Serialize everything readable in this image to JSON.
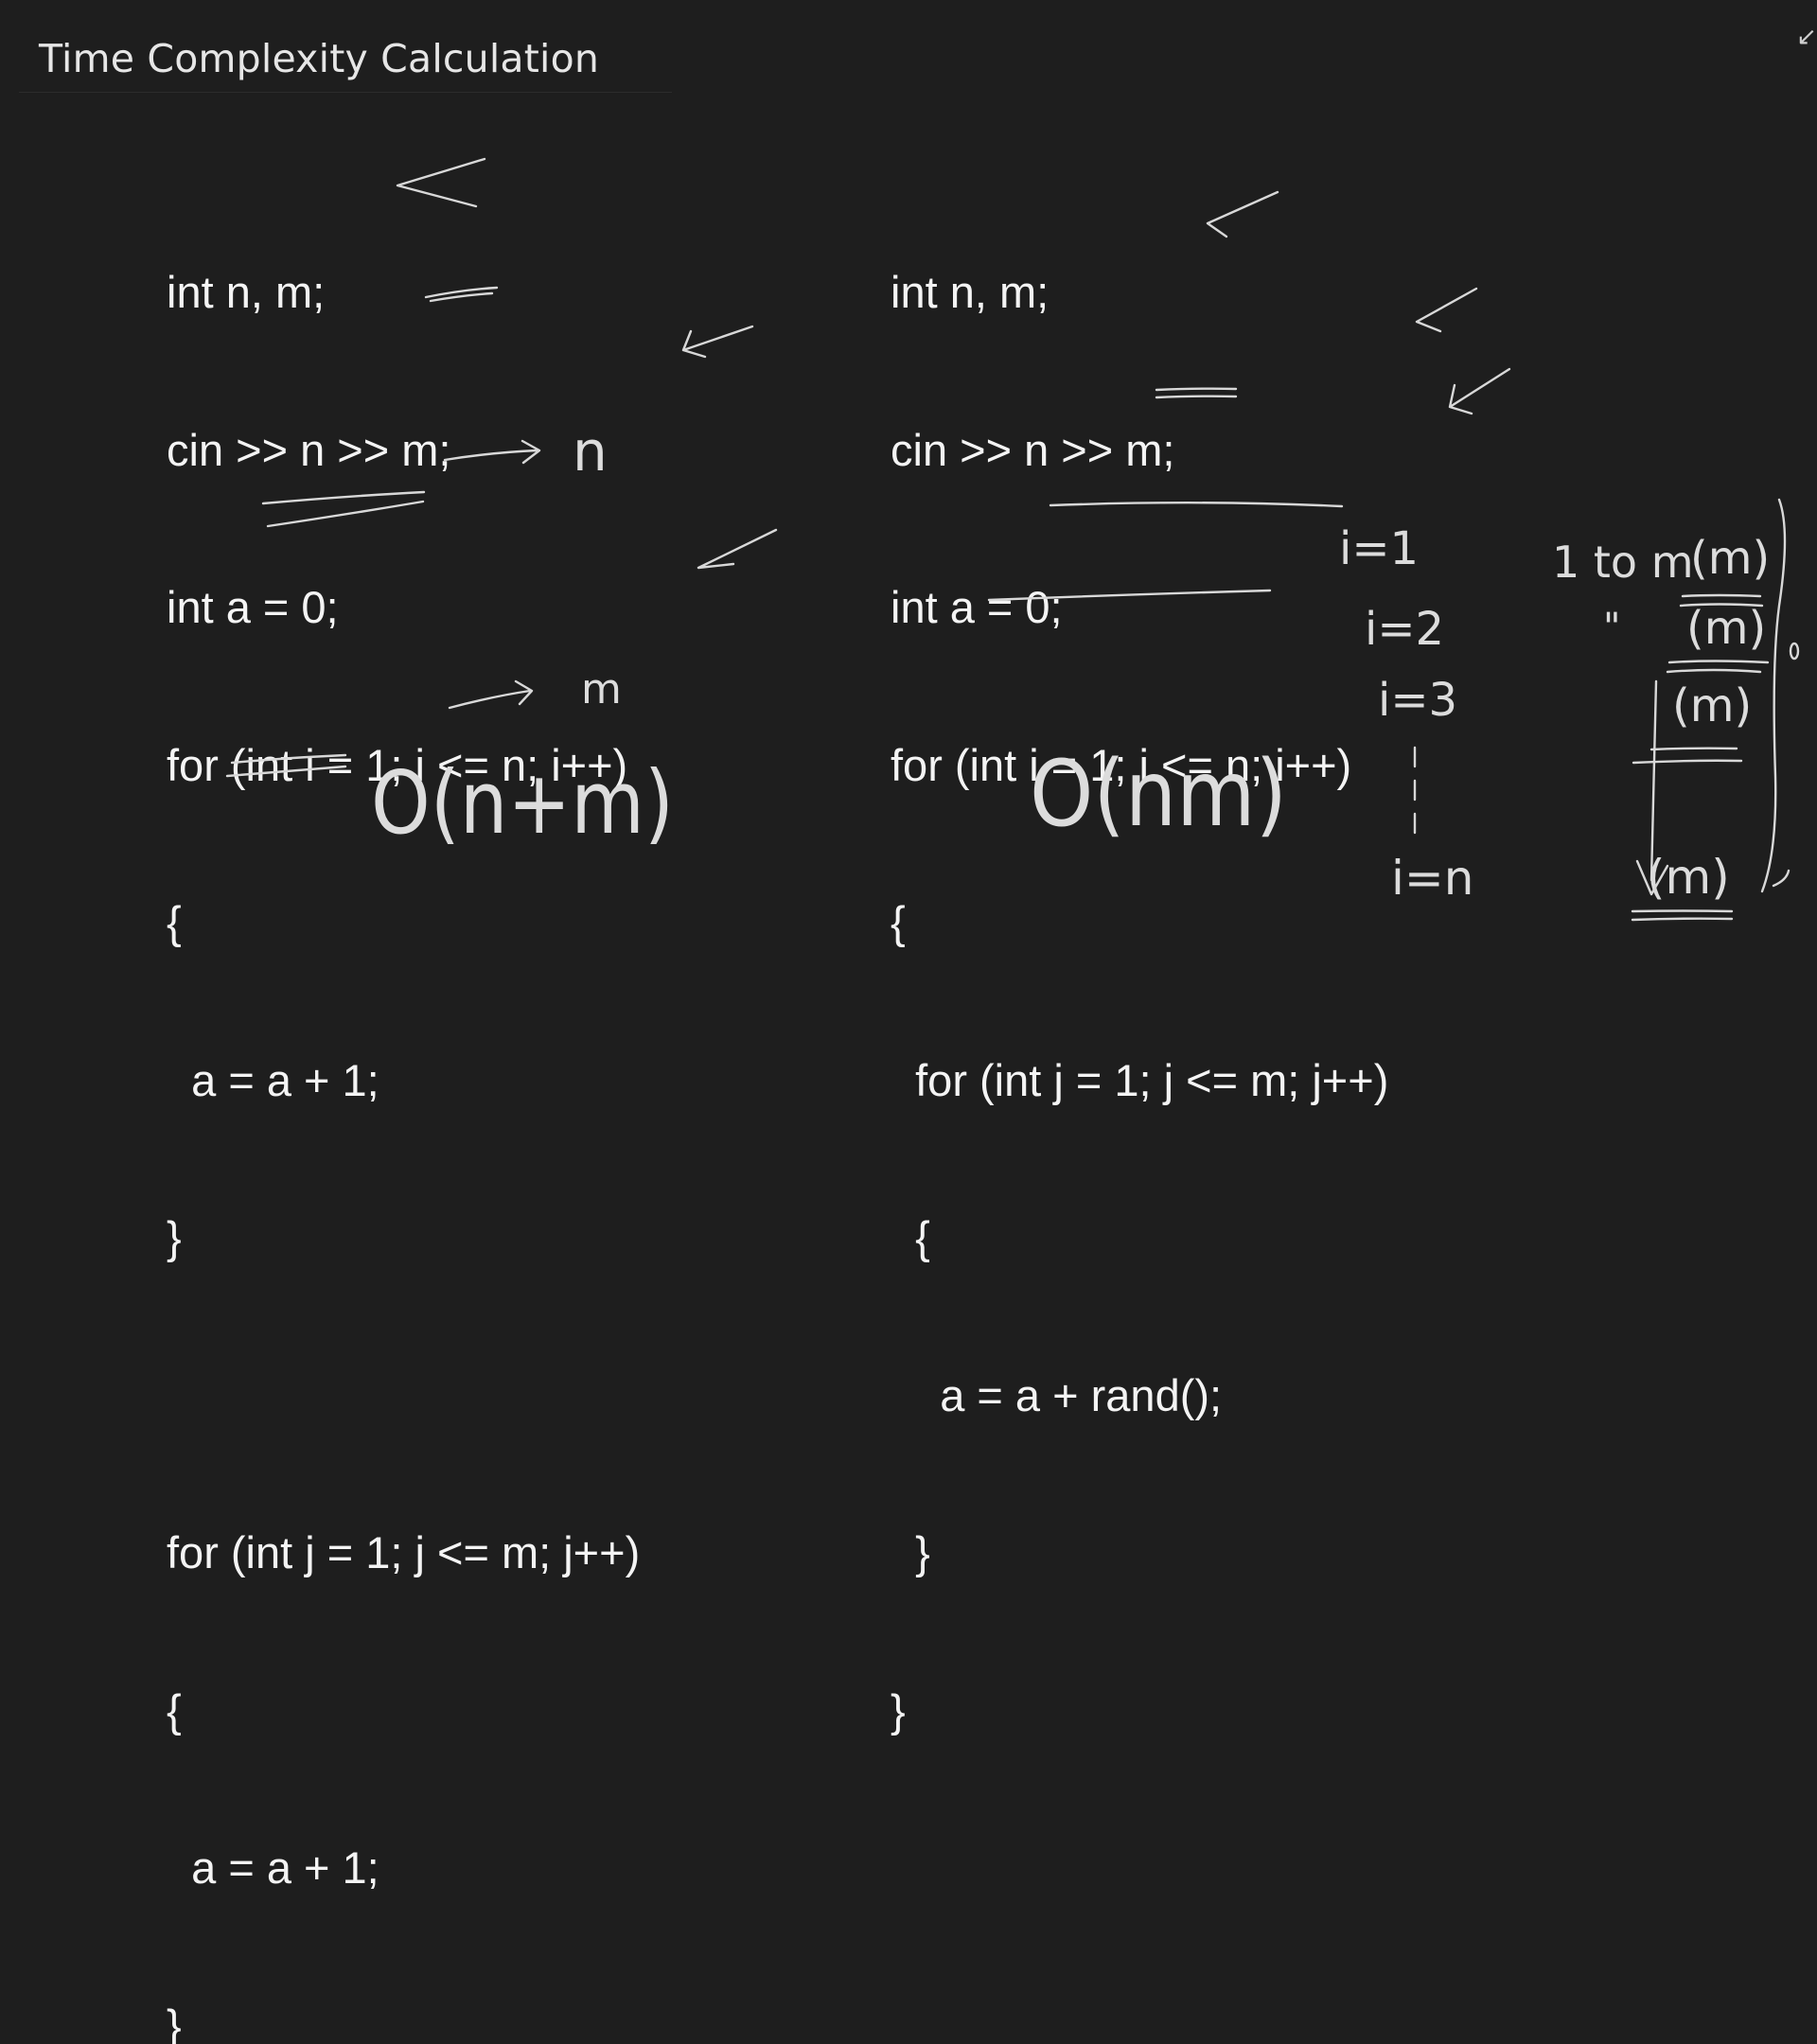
{
  "slide": {
    "title": "Time Complexity Calculation",
    "corner_glyph": "↙"
  },
  "left_code": {
    "lines": [
      "int n, m;",
      "cin >> n >> m;",
      "int a = 0;",
      "for (int i = 1; i <= n; i++)",
      "{",
      "  a = a + 1;",
      "}",
      "",
      "for (int j = 1; j <= m; j++)",
      "{",
      "  a = a + 1;",
      "}"
    ]
  },
  "right_code": {
    "lines": [
      "int n, m;",
      "cin >> n >> m;",
      "int a = 0;",
      "for (int i = 1; i <= n; i++)",
      "{",
      "  for (int j = 1; j <= m; j++)",
      "  {",
      "    a = a + rand();",
      "  }",
      "}"
    ]
  },
  "annotations": {
    "first_loop_cost": "n",
    "second_loop_cost": "m",
    "left_result": "O(n+m)",
    "right_result": "O(nm)",
    "iter_1": "i=1",
    "iter_2": "i=2",
    "iter_3": "i=3",
    "iter_n": "i=n",
    "range_note": "1 to m",
    "ditto": "\"",
    "inner_cost_1": "(m)",
    "inner_cost_2": "(m)",
    "inner_cost_3": "(m)",
    "inner_cost_n": "(m)"
  },
  "colors": {
    "background": "#1e1e1e",
    "code_text": "#f4f4f4",
    "ink": "#d8d8d8"
  }
}
